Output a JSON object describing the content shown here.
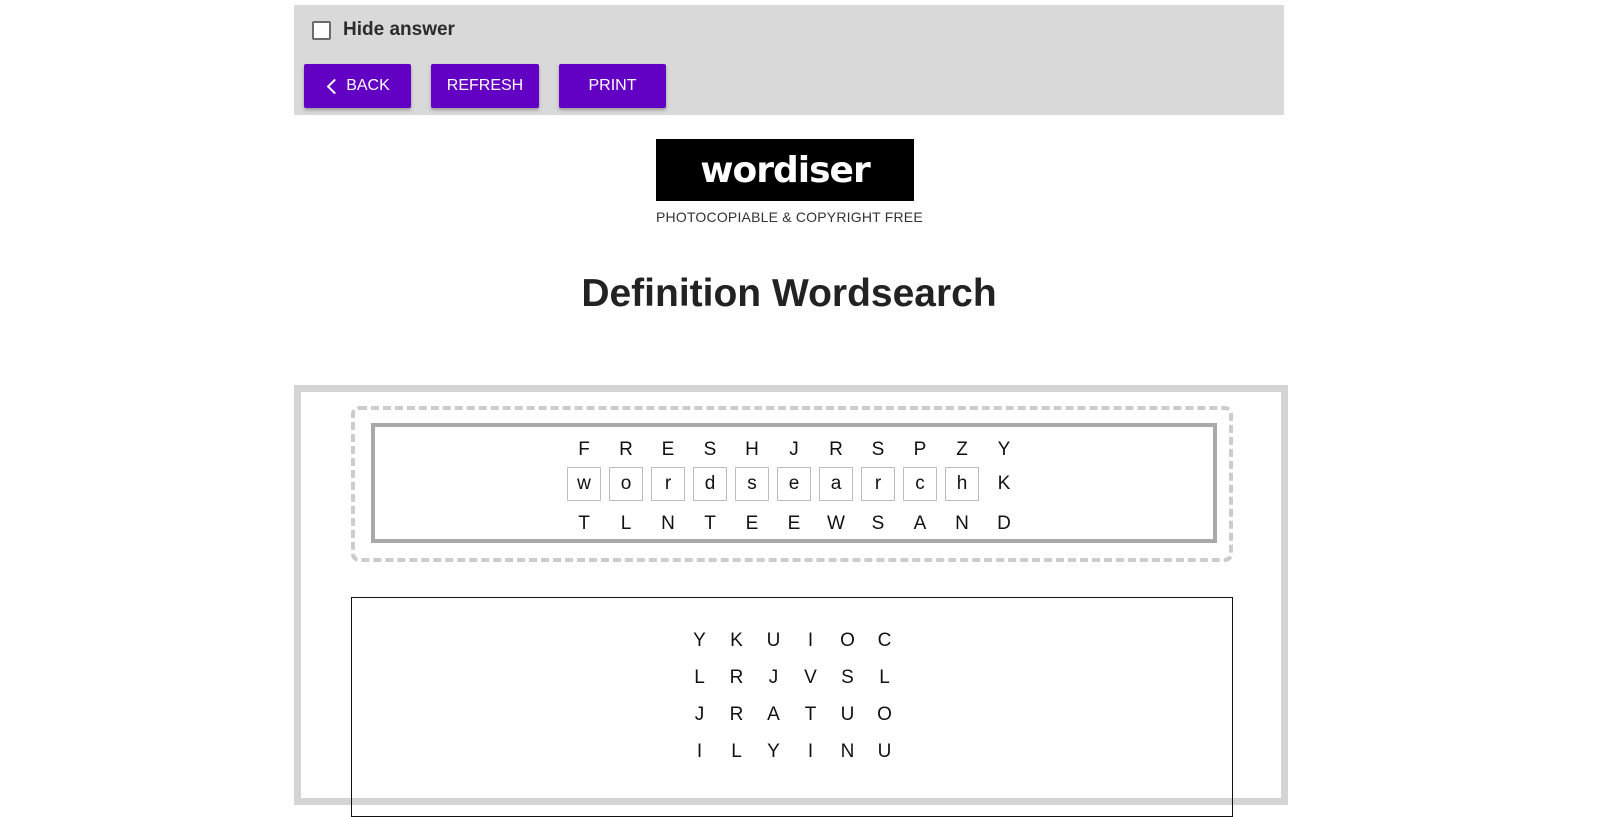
{
  "toolbar": {
    "hide_answer_label": "Hide answer",
    "back_label": "BACK",
    "refresh_label": "REFRESH",
    "print_label": "PRINT"
  },
  "brand": {
    "logo_text": "wordiser",
    "tagline": "PHOTOCOPIABLE & COPYRIGHT FREE"
  },
  "page": {
    "title": "Definition Wordsearch"
  },
  "example": {
    "rows": [
      [
        "F",
        "R",
        "E",
        "S",
        "H",
        "J",
        "R",
        "S",
        "P",
        "Z",
        "Y"
      ],
      [
        "w",
        "o",
        "r",
        "d",
        "s",
        "e",
        "a",
        "r",
        "c",
        "h",
        "K"
      ],
      [
        "T",
        "L",
        "N",
        "T",
        "E",
        "E",
        "W",
        "S",
        "A",
        "N",
        "D"
      ]
    ],
    "highlighted_word": "wordsearch"
  },
  "grid": {
    "rows": [
      [
        "Y",
        "K",
        "U",
        "I",
        "O",
        "C"
      ],
      [
        "L",
        "R",
        "J",
        "V",
        "S",
        "L"
      ],
      [
        "J",
        "R",
        "A",
        "T",
        "U",
        "O"
      ],
      [
        "I",
        "L",
        "Y",
        "I",
        "N",
        "U"
      ]
    ]
  },
  "colors": {
    "button_bg": "#6200c4",
    "toolbar_bg": "#d9d9d9",
    "frame_border": "#d4d4d4"
  }
}
